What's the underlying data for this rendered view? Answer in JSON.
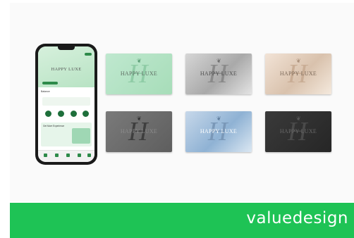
{
  "brand": {
    "name": "valuedesign",
    "color": "#1ec355"
  },
  "app": {
    "hero_title": "HAPPY LUXE",
    "balance_label": "Balance",
    "promo_title": "Get More Experience"
  },
  "cards": [
    {
      "label": "HAPPY LUXE",
      "style": "mint"
    },
    {
      "label": "HAPPY LUXE",
      "style": "silver"
    },
    {
      "label": "HAPPY LUXE",
      "style": "champagne"
    },
    {
      "label": "HAPPY LUXE",
      "style": "graphite"
    },
    {
      "label": "HAPPY LUXE",
      "style": "ice-blue"
    },
    {
      "label": "HAPPY LUXE",
      "style": "black"
    }
  ],
  "monogram": "H",
  "icons": {
    "leaf": "leaf-icon"
  }
}
